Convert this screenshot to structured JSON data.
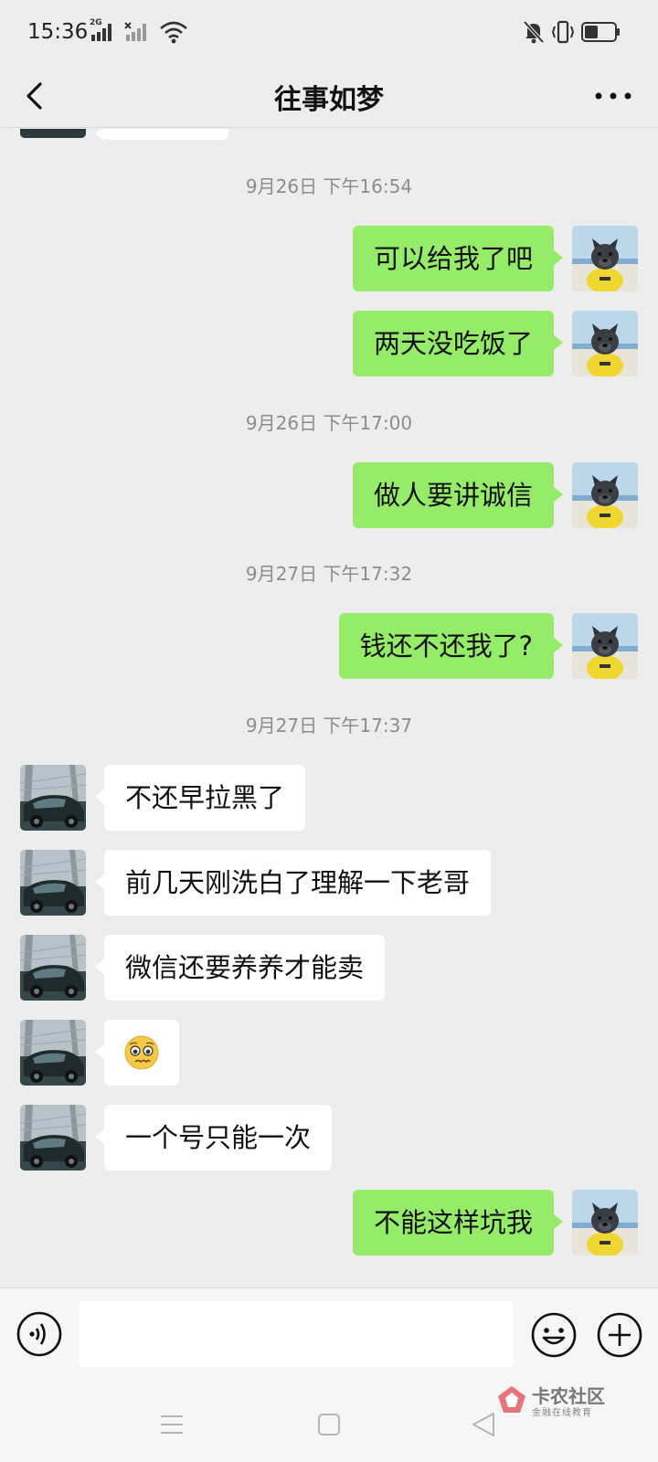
{
  "status_bar": {
    "time": "15:36",
    "sim1_label": "2G",
    "battery_level": 0.4,
    "icons": [
      "signal-2g-icon",
      "signal-no-sim-icon",
      "wifi-icon",
      "mute-icon",
      "vibrate-icon",
      "battery-icon"
    ]
  },
  "header": {
    "title": "往事如梦",
    "back_icon": "chevron-left-icon",
    "more_icon": "more-dots-icon"
  },
  "messages": [
    {
      "type": "timestamp",
      "text": "9月26日 下午16:54"
    },
    {
      "type": "bubble",
      "from": "me",
      "text": "可以给我了吧"
    },
    {
      "type": "bubble",
      "from": "me",
      "text": "两天没吃饭了"
    },
    {
      "type": "timestamp",
      "text": "9月26日 下午17:00"
    },
    {
      "type": "bubble",
      "from": "me",
      "text": "做人要讲诚信"
    },
    {
      "type": "timestamp",
      "text": "9月27日 下午17:32"
    },
    {
      "type": "bubble",
      "from": "me",
      "text": "钱还不还我了?"
    },
    {
      "type": "timestamp",
      "text": "9月27日 下午17:37"
    },
    {
      "type": "bubble",
      "from": "them",
      "text": "不还早拉黑了"
    },
    {
      "type": "bubble",
      "from": "them",
      "text": "前几天刚洗白了理解一下老哥"
    },
    {
      "type": "bubble",
      "from": "them",
      "text": "微信还要养养才能卖"
    },
    {
      "type": "bubble",
      "from": "them",
      "emoji": "pleading-face-emoji"
    },
    {
      "type": "bubble",
      "from": "them",
      "text": "一个号只能一次"
    },
    {
      "type": "bubble",
      "from": "me",
      "text": "不能这样坑我"
    }
  ],
  "input_bar": {
    "placeholder": "",
    "voice_icon": "voice-icon",
    "emoji_icon": "smiley-icon",
    "plus_icon": "plus-icon"
  },
  "nav_bar": {
    "icons": [
      "menu-icon",
      "home-icon",
      "back-triangle-icon"
    ]
  },
  "watermark": {
    "title": "卡农社区",
    "subtitle": "金融在线教育"
  },
  "colors": {
    "background": "#ededed",
    "my_bubble": "#95ec69",
    "their_bubble": "#ffffff",
    "timestamp": "#8c8c8c"
  }
}
